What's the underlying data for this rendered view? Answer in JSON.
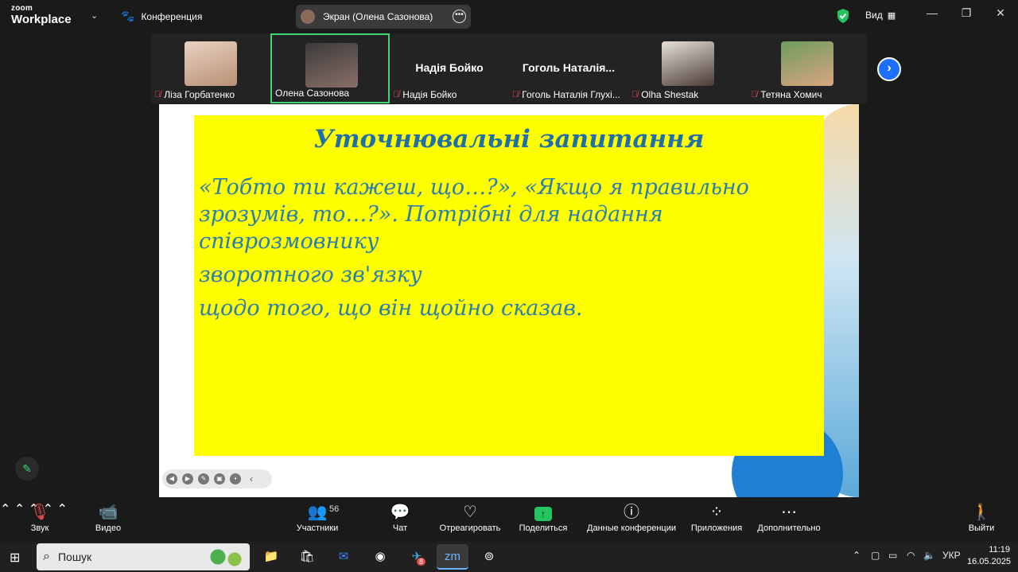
{
  "app": {
    "brand_small": "zoom",
    "brand_big": "Workplace"
  },
  "titlebar": {
    "conference_label": "Конференция",
    "screen_share_label": "Экран (Олена Сазонова)",
    "view_label": "Вид"
  },
  "participants": [
    {
      "name": "Ліза Горбатенко",
      "video": true,
      "muted": true,
      "active": false,
      "photo_color": "#d9b8a0"
    },
    {
      "name": "Олена Сазонова",
      "video": true,
      "muted": false,
      "active": true,
      "photo_color": "#6d5c58"
    },
    {
      "name": "Надія Бойко",
      "video": false,
      "muted": true,
      "active": false,
      "big_name": "Надія Бойко"
    },
    {
      "name": "Гоголь Наталія Глухі...",
      "video": false,
      "muted": true,
      "active": false,
      "big_name": "Гоголь  Наталія..."
    },
    {
      "name": "Olha Shestak",
      "video": true,
      "muted": true,
      "active": false,
      "photo_color": "#cfc6bf"
    },
    {
      "name": "Тетяна Хомич",
      "video": true,
      "muted": true,
      "active": false,
      "photo_color": "#7aa36a"
    }
  ],
  "slide": {
    "title": "Уточнювальні запитання",
    "paragraphs": [
      "«Тобто ти кажеш, що…?», «Якщо я правильно зрозумів, то…?». Потрібні для надання співрозмовнику",
      "зворотного зв'язку",
      "щодо того, що він щойно сказав."
    ]
  },
  "toolbar": {
    "audio": "Звук",
    "video": "Видео",
    "participants": "Участники",
    "participants_count": "56",
    "chat": "Чат",
    "react": "Отреагировать",
    "share": "Поделиться",
    "meeting_info": "Данные конференции",
    "apps": "Приложения",
    "more": "Дополнительно",
    "leave": "Выйти"
  },
  "taskbar": {
    "search_placeholder": "Пошук",
    "lang": "УКР",
    "time": "11:19",
    "date": "16.05.2025",
    "telegram_badge": "8"
  },
  "colors": {
    "accent_green": "#3bd671",
    "slide_yellow": "#ffff00",
    "slide_text": "#2a7fb0",
    "leave_red": "#e24b4b"
  }
}
